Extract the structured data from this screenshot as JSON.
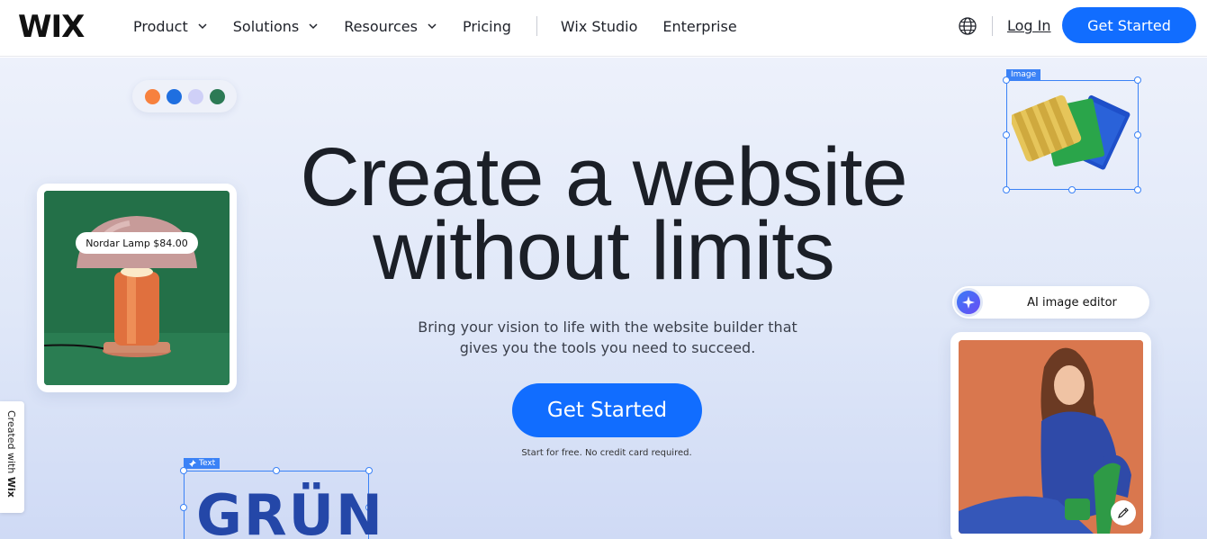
{
  "nav": {
    "logo": "WIX",
    "items": [
      {
        "label": "Product",
        "has_menu": true
      },
      {
        "label": "Solutions",
        "has_menu": true
      },
      {
        "label": "Resources",
        "has_menu": true
      },
      {
        "label": "Pricing",
        "has_menu": false
      }
    ],
    "items_right": [
      {
        "label": "Wix Studio"
      },
      {
        "label": "Enterprise"
      }
    ],
    "login": "Log In",
    "cta": "Get Started"
  },
  "hero": {
    "headline_line1": "Create a website",
    "headline_line2": "without limits",
    "sub_line1": "Bring your vision to life with the website builder that",
    "sub_line2": "gives you the tools you need to succeed.",
    "cta": "Get Started",
    "fine_print": "Start for free. No credit card required.",
    "color_swatches": [
      "#f7813e",
      "#1f6fe0",
      "#cfd0f7",
      "#2c7a55"
    ]
  },
  "cards": {
    "lamp_price": "Nordar Lamp $84.00",
    "image_tag": "Image",
    "text_tag": "Text",
    "text_sample": "GRÜN",
    "ai_editor": "AI image editor"
  },
  "badge": {
    "prefix": "Created with",
    "brand": "Wix"
  },
  "colors": {
    "accent": "#116dff",
    "selection": "#3b82f6"
  }
}
